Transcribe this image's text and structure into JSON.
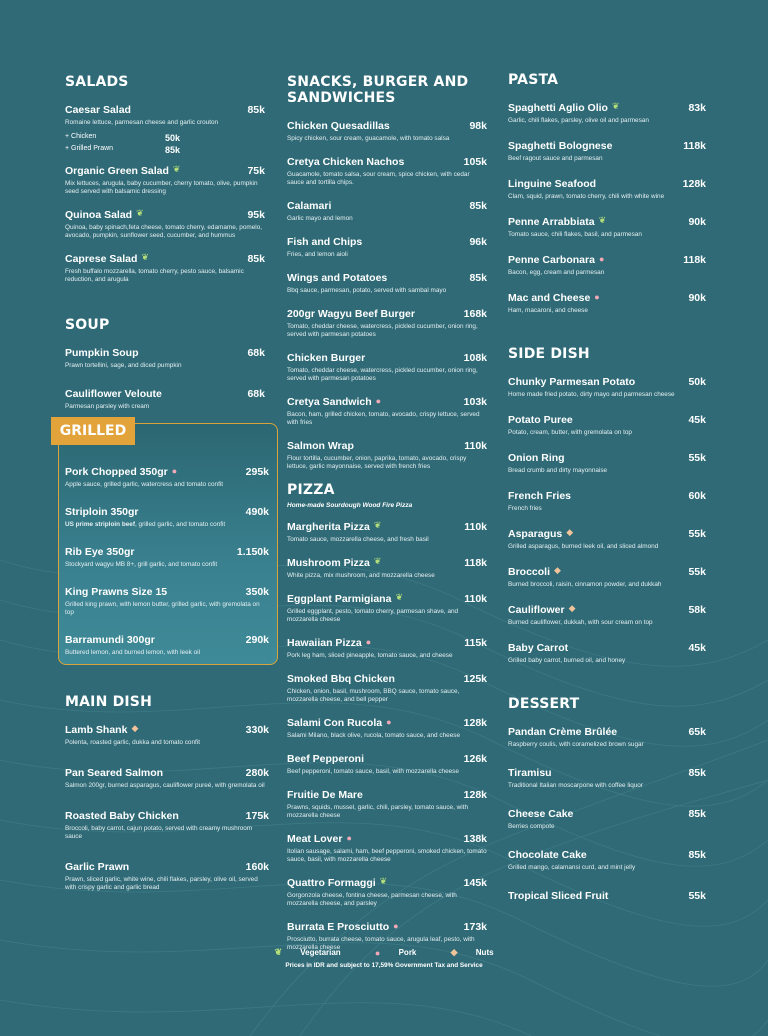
{
  "salads": {
    "title": "SALADS",
    "items": [
      {
        "name": "Caesar Salad",
        "price": "85k",
        "desc": "Romaine lettuce, parmesan cheese and garlic crouton",
        "icon": ""
      },
      {
        "name": "Organic Green Salad",
        "price": "75k",
        "desc": "Mix lettuces, arugula, baby cucumber, cherry tomato, olive, pumpkin seed served with balsamic dressing",
        "icon": "veg"
      },
      {
        "name": "Quinoa Salad",
        "price": "95k",
        "desc": "Quinoa, baby spinach,feta cheese, tomato cherry, edamame, pomelo, avocado, pumpkin, sunflower seed, cucumber, and hummus",
        "icon": "veg"
      },
      {
        "name": "Caprese Salad",
        "price": "85k",
        "desc": "Fresh buffalo mozzarella, tomato cherry, pesto sauce, balsamic reduction, and arugula",
        "icon": "veg"
      }
    ],
    "addons": [
      {
        "label": "+ Chicken",
        "price": "50k"
      },
      {
        "label": "+ Grilled Prawn",
        "price": "85k"
      }
    ]
  },
  "soup": {
    "title": "SOUP",
    "items": [
      {
        "name": "Pumpkin Soup",
        "price": "68k",
        "desc": "Prawn tortellini, sage, and diced pumpkin"
      },
      {
        "name": "Cauliflower Veloute",
        "price": "68k",
        "desc": "Parmesan parsley with cream"
      }
    ]
  },
  "grilled": {
    "title": "GRILLED",
    "items": [
      {
        "name": "Pork Chopped 350gr",
        "price": "295k",
        "desc": "Apple sauce, grilled garlic, watercress and tomato confit",
        "icon": "pork"
      },
      {
        "name": "Striploin 350gr",
        "price": "490k",
        "desc_bold": "US prime striploin beef",
        "desc": ", grilled garlic, and tomato confit"
      },
      {
        "name": "Rib Eye 350gr",
        "price": "1.150k",
        "desc": "Stockyard wagyu MB 8+, grill garlic, and tomato confit"
      },
      {
        "name": "King Prawns Size 15",
        "price": "350k",
        "desc": "Grilled king prawn, with lemon butter, grilled garlic, with gremolata on top"
      },
      {
        "name": "Barramundi 300gr",
        "price": "290k",
        "desc": "Buttered lemon, and burned lemon, with leek oil"
      }
    ]
  },
  "main": {
    "title": "MAIN DISH",
    "items": [
      {
        "name": "Lamb Shank",
        "price": "330k",
        "desc": "Polenta, roasted garlic, dukka and tomato confit",
        "icon": "nuts"
      },
      {
        "name": "Pan Seared Salmon",
        "price": "280k",
        "desc": "Salmon 200gr, burned asparagus, cauliflower pureé, with gremolata oil"
      },
      {
        "name": "Roasted Baby Chicken",
        "price": "175k",
        "desc": "Broccoli, baby carrot, cajun potato, served with creamy mushroom sauce"
      },
      {
        "name": "Garlic Prawn",
        "price": "160k",
        "desc": "Prawn, sliced garlic, white wine, chili flakes, parsley, olive oil, served with crispy garlic and garlic bread"
      }
    ]
  },
  "snacks": {
    "title": "SNACKS, BURGER AND SANDWICHES",
    "items": [
      {
        "name": "Chicken Quesadillas",
        "price": "98k",
        "desc": "Spicy chicken, sour cream, guacamole, with tomato salsa"
      },
      {
        "name": "Cretya Chicken Nachos",
        "price": "105k",
        "desc": "Guacamole, tomato salsa, sour cream, spice chicken, with cedar sauce and tortilla chips."
      },
      {
        "name": "Calamari",
        "price": "85k",
        "desc": "Garlic mayo and lemon"
      },
      {
        "name": "Fish and Chips",
        "price": "96k",
        "desc": "Fries, and lemon aioli"
      },
      {
        "name": "Wings and Potatoes",
        "price": "85k",
        "desc": "Bbq sauce, parmesan, potato, served with sambal mayo"
      },
      {
        "name": "200gr Wagyu Beef Burger",
        "price": "168k",
        "desc": "Tomato, cheddar cheese, watercress, pickled cucumber, onion ring, served with parmesan potatoes"
      },
      {
        "name": "Chicken Burger",
        "price": "108k",
        "desc": "Tomato, cheddar cheese, watercress, pickled cucumber, onion ring, served with parmesan potatoes"
      },
      {
        "name": "Cretya Sandwich",
        "price": "103k",
        "desc": "Bacon, ham, grilled chicken, tomato, avocado, crispy lettuce, served with fries",
        "icon": "pork"
      },
      {
        "name": "Salmon Wrap",
        "price": "110k",
        "desc": "Flour tortilla, cucumber, onion, paprika, tomato, avocado, crispy lettuce, garlic mayonnaise, served with french fries"
      }
    ]
  },
  "pizza": {
    "title": "PIZZA",
    "subtitle": "Home-made Sourdough Wood Fire Pizza",
    "items": [
      {
        "name": "Margherita Pizza",
        "price": "110k",
        "desc": "Tomato sauce, mozzarella cheese, and fresh basil",
        "icon": "veg"
      },
      {
        "name": "Mushroom Pizza",
        "price": "118k",
        "desc": "White pizza, mix mushroom, and mozzarella cheese",
        "icon": "veg"
      },
      {
        "name": "Eggplant Parmigiana",
        "price": "110k",
        "desc": "Grilled eggplant, pesto, tomato cherry, parmesan shave, and mozzarella cheese",
        "icon": "veg"
      },
      {
        "name": "Hawaiian Pizza",
        "price": "115k",
        "desc": "Pork leg ham, sliced pineapple, tomato sauce, and cheese",
        "icon": "pork"
      },
      {
        "name": "Smoked Bbq Chicken",
        "price": "125k",
        "desc": "Chicken, onion, basil, mushroom, BBQ sauce, tomato sauce, mozzarella cheese, and bell pepper"
      },
      {
        "name": "Salami Con Rucola",
        "price": "128k",
        "desc": "Salami Milano, black olive, rucola, tomato sauce, and cheese",
        "icon": "pork"
      },
      {
        "name": "Beef Pepperoni",
        "price": "126k",
        "desc": "Beef pepperoni, tomato sauce, basil, with mozzarella cheese"
      },
      {
        "name": "Fruitie De Mare",
        "price": "128k",
        "desc": "Prawns, squids, mussel, garlic, chili, parsley, tomato sauce, with mozzarella cheese"
      },
      {
        "name": "Meat Lover",
        "price": "138k",
        "desc": "Itolian sausage, salami, ham, beef pepperoni, smoked chicken, tomato sauce, basil, with mozzarella cheese",
        "icon": "pork"
      },
      {
        "name": "Quattro Formaggi",
        "price": "145k",
        "desc": "Gorgonzola cheese, fontina cheese, parmesan cheese, with mozzarella cheese, and parsley",
        "icon": "veg"
      },
      {
        "name": "Burrata E Prosciutto",
        "price": "173k",
        "desc": "Prosciutto, burrata cheese, tomato sauce, arugula leaf, pesto, with mozzarella cheese",
        "icon": "pork"
      }
    ]
  },
  "pasta": {
    "title": "PASTA",
    "items": [
      {
        "name": "Spaghetti Aglio Olio",
        "price": "83k",
        "desc": "Garlic, chili flakes, parsley, olive oil and parmesan",
        "icon": "veg"
      },
      {
        "name": "Spaghetti Bolognese",
        "price": "118k",
        "desc": "Beef ragout sauce and parmesan"
      },
      {
        "name": "Linguine Seafood",
        "price": "128k",
        "desc": "Clam, squid, prawn, tomato cherry, chili with white wine"
      },
      {
        "name": "Penne Arrabbiata",
        "price": "90k",
        "desc": "Tomato sauce, chili flakes, basil, and parmesan",
        "icon": "veg"
      },
      {
        "name": "Penne Carbonara",
        "price": "118k",
        "desc": "Bacon, egg, cream and parmesan",
        "icon": "pork"
      },
      {
        "name": "Mac and Cheese",
        "price": "90k",
        "desc": "Ham, macaroni, and cheese",
        "icon": "pork"
      }
    ]
  },
  "side": {
    "title": "SIDE DISH",
    "items": [
      {
        "name": "Chunky Parmesan Potato",
        "price": "50k",
        "desc": "Home made fried potato, dirty mayo and parmesan cheese"
      },
      {
        "name": "Potato Puree",
        "price": "45k",
        "desc": "Potato, cream, butter, with gremolata on top"
      },
      {
        "name": "Onion Ring",
        "price": "55k",
        "desc": "Bread crumb and dirty mayonnaise"
      },
      {
        "name": "French Fries",
        "price": "60k",
        "desc": "French fries"
      },
      {
        "name": "Asparagus",
        "price": "55k",
        "desc": "Grilled asparagus, burned leek oil, and sliced almond",
        "icon": "nuts"
      },
      {
        "name": "Broccoli",
        "price": "55k",
        "desc": "Burned broccoli, raisin, cinnamon powder, and dukkah",
        "icon": "nuts"
      },
      {
        "name": "Cauliflower",
        "price": "58k",
        "desc": "Burned cauliflower, dukkah, with sour cream on top",
        "icon": "nuts"
      },
      {
        "name": "Baby Carrot",
        "price": "45k",
        "desc": "Grilled baby carrot, burned oil, and honey"
      }
    ]
  },
  "dessert": {
    "title": "DESSERT",
    "items": [
      {
        "name": "Pandan Crème Brûlée",
        "price": "65k",
        "desc": "Raspberry coulis, with coramelized brown sugar"
      },
      {
        "name": "Tiramisu",
        "price": "85k",
        "desc": "Traditional Italian moscarpone with coffee liquor"
      },
      {
        "name": "Cheese Cake",
        "price": "85k",
        "desc": "Berries compote"
      },
      {
        "name": "Chocolate Cake",
        "price": "85k",
        "desc": "Grilled mango, calamansi curd, and mint jelly"
      },
      {
        "name": "Tropical Sliced Fruit",
        "price": "55k",
        "desc": ""
      }
    ]
  },
  "legend": {
    "veg": "Vegetarian",
    "pork": "Pork",
    "nuts": "Nuts",
    "note": "Prices in IDR and subject to 17,59% Government Tax and Service"
  },
  "icons": {
    "veg": "leaf-icon",
    "pork": "pig-icon",
    "nuts": "nut-icon"
  },
  "colors": {
    "background": "#2f6a76",
    "accent": "#e2a33a"
  }
}
